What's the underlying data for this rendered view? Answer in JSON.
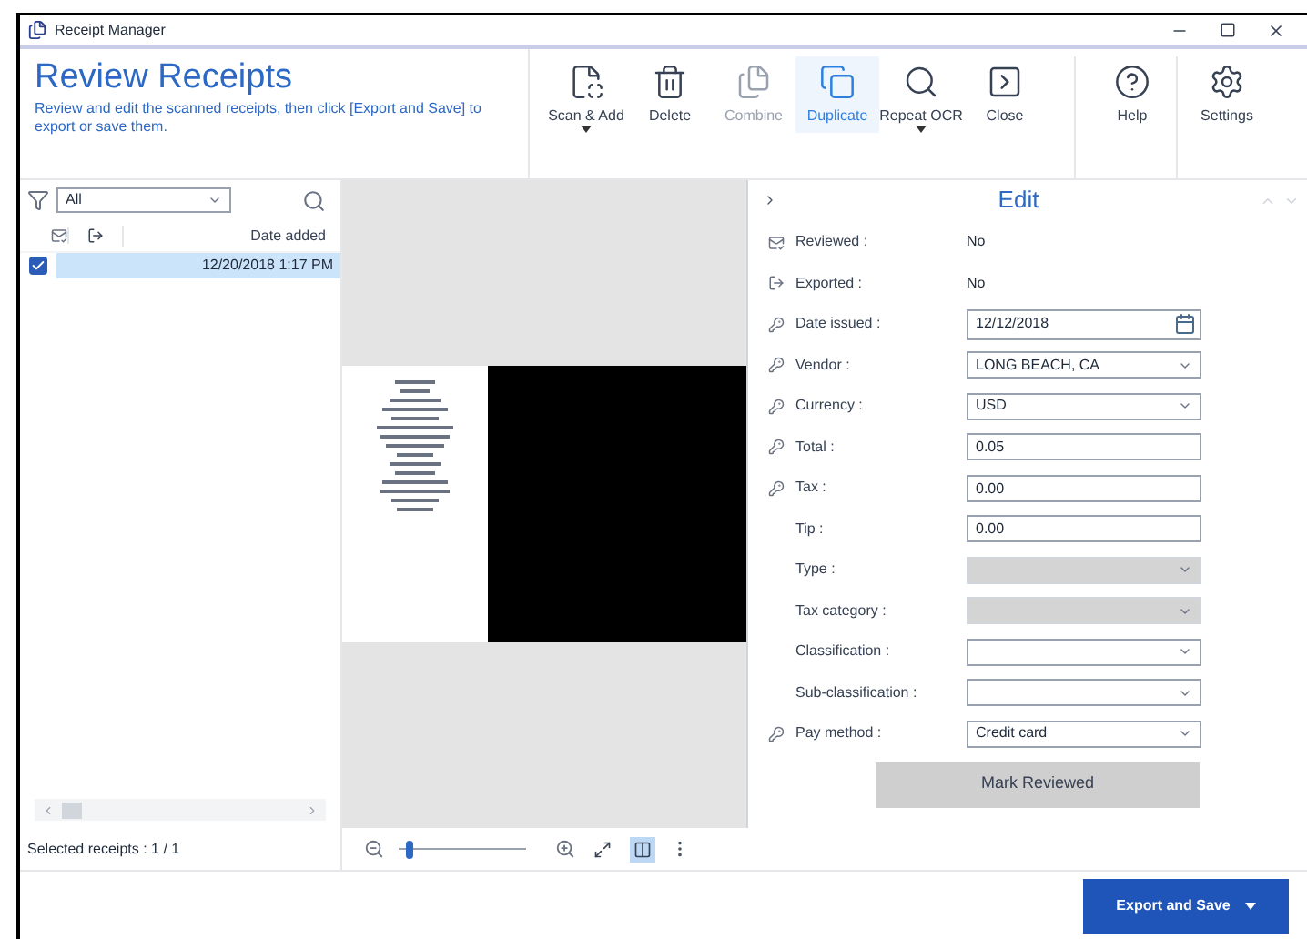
{
  "window": {
    "title": "Receipt Manager"
  },
  "header": {
    "title": "Review Receipts",
    "subtitle": "Review and edit the scanned receipts, then click [Export and Save] to export or save them."
  },
  "toolbar": [
    {
      "label": "Scan & Add",
      "kind": "scan",
      "dropdown": true,
      "disabled": false,
      "highlighted": false
    },
    {
      "label": "Delete",
      "kind": "delete",
      "dropdown": false,
      "disabled": false,
      "highlighted": false
    },
    {
      "label": "Combine",
      "kind": "combine",
      "dropdown": false,
      "disabled": true,
      "highlighted": false
    },
    {
      "label": "Duplicate",
      "kind": "duplicate",
      "dropdown": false,
      "disabled": false,
      "highlighted": true
    },
    {
      "label": "Repeat OCR",
      "kind": "ocr",
      "dropdown": true,
      "disabled": false,
      "highlighted": false
    },
    {
      "label": "Close",
      "kind": "close",
      "dropdown": false,
      "disabled": false,
      "highlighted": false
    },
    {
      "label": "Help",
      "kind": "help",
      "dropdown": false,
      "disabled": false,
      "highlighted": false
    },
    {
      "label": "Settings",
      "kind": "settings",
      "dropdown": false,
      "disabled": false,
      "highlighted": false
    }
  ],
  "filter": {
    "value": "All"
  },
  "table": {
    "columns": [
      "Date added"
    ],
    "rows": [
      {
        "checked": true,
        "selected": true,
        "date_added": "12/20/2018 1:17 PM"
      }
    ]
  },
  "status_bar": "Selected receipts : 1 / 1",
  "viewer": {
    "zoom": {
      "level": 0.05
    },
    "view_modes": [
      {
        "kind": "fit",
        "selected": false
      },
      {
        "kind": "spread",
        "selected": true
      }
    ]
  },
  "edit": {
    "title": "Edit",
    "fields": [
      {
        "label": "Reviewed :",
        "kind": "reviewed",
        "value": "No"
      },
      {
        "label": "Exported :",
        "kind": "exported",
        "value": "No"
      },
      {
        "label": "Date issued :",
        "kind": "date",
        "required": true,
        "value": "12/12/2018",
        "disabled": false
      },
      {
        "label": "Vendor :",
        "kind": "dropdown",
        "required": true,
        "value": "LONG BEACH, CA",
        "disabled": false
      },
      {
        "label": "Currency :",
        "kind": "dropdown",
        "required": true,
        "value": "USD",
        "disabled": false
      },
      {
        "label": "Total :",
        "kind": "text",
        "required": true,
        "value": "0.05",
        "disabled": false
      },
      {
        "label": "Tax :",
        "kind": "text",
        "required": true,
        "value": "0.00",
        "disabled": false
      },
      {
        "label": "Tip :",
        "kind": "text",
        "required": false,
        "value": "0.00",
        "disabled": false
      },
      {
        "label": "Type :",
        "kind": "dropdown",
        "required": false,
        "disabled": true
      },
      {
        "label": "Tax category :",
        "kind": "dropdown",
        "required": false,
        "disabled": true
      },
      {
        "label": "Classification :",
        "kind": "dropdown",
        "required": false,
        "disabled": false
      },
      {
        "label": "Sub-classification :",
        "kind": "dropdown",
        "required": false,
        "disabled": false
      },
      {
        "label": "Pay method :",
        "kind": "dropdown",
        "required": true,
        "value": "Credit card",
        "disabled": false
      }
    ],
    "action": "Mark Reviewed"
  },
  "footer": {
    "button": "Export and Save"
  }
}
